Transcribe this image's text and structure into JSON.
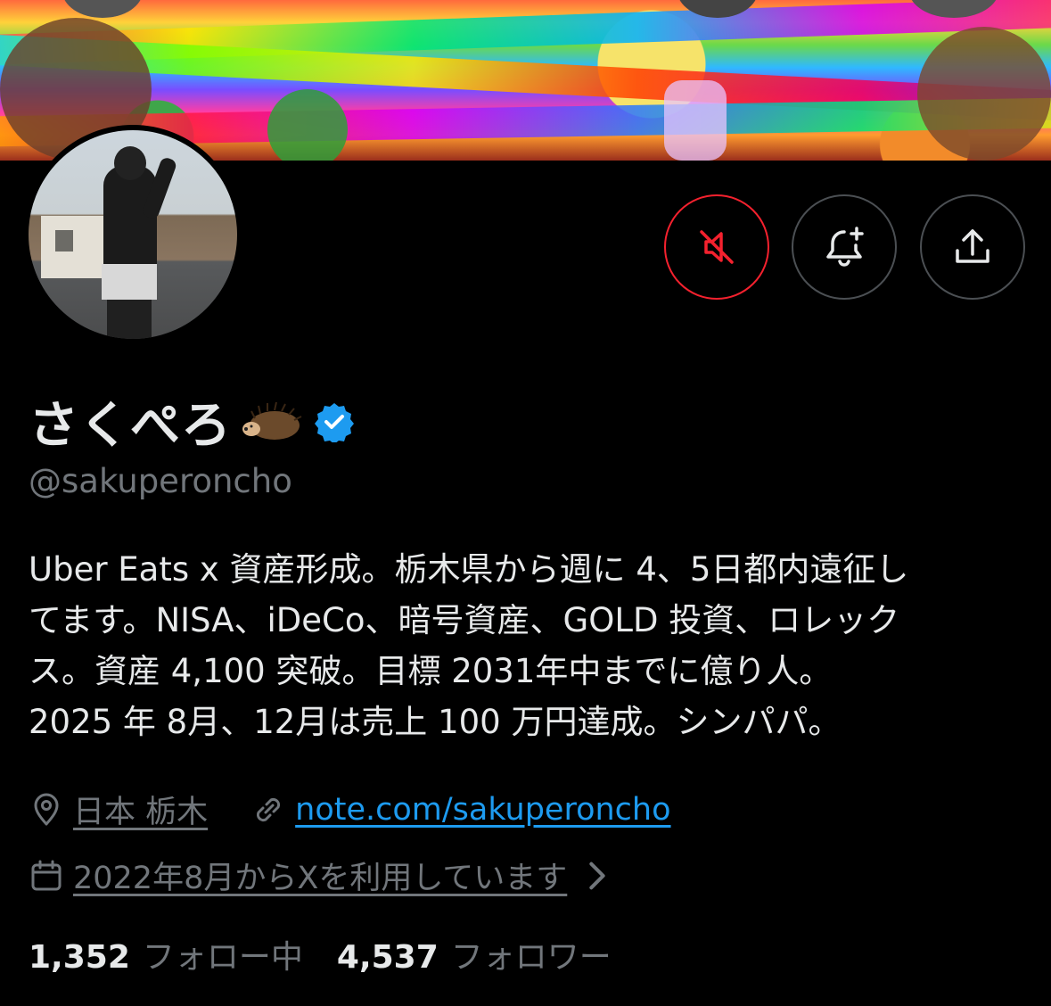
{
  "profile": {
    "display_name": "さくぺろ",
    "handle": "@sakuperoncho",
    "bio": "Uber Eats x 資産形成。栃木県から週に 4、5日都内遠征し\nてます。NISA、iDeCo、暗号資産、GOLD 投資、ロレック\nス。資産 4,100 突破。目標 2031年中までに億り人。\n2025 年 8月、12月は売上 100 万円達成。シンパパ。",
    "location": "日本 栃木",
    "website": "note.com/sakuperoncho",
    "joined": "2022年8月からXを利用しています"
  },
  "stats": {
    "following_count": "1,352",
    "following_label": "フォロー中",
    "followers_count": "4,537",
    "followers_label": "フォロワー"
  },
  "icons": {
    "mute": "speaker-muted-icon",
    "notify": "bell-plus-icon",
    "share": "share-icon",
    "verified": "verified-badge-icon",
    "emoji": "hedgehog-icon",
    "location": "location-pin-icon",
    "link": "link-icon",
    "calendar": "calendar-icon"
  },
  "colors": {
    "background": "#000000",
    "text": "#e7e9ea",
    "secondary": "#71767b",
    "link": "#1d9bf0",
    "mute_accent": "#f4212e",
    "verified": "#1d9bf0"
  }
}
